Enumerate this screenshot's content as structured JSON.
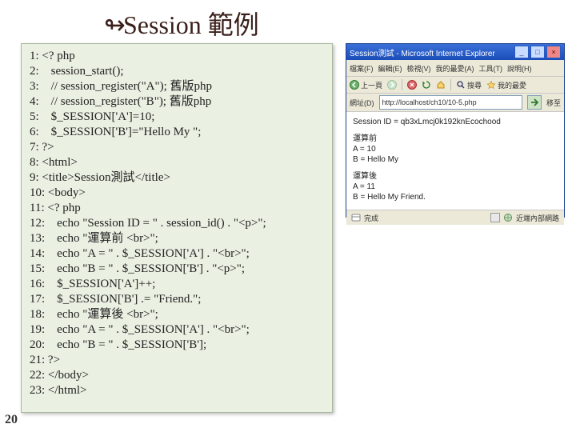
{
  "title_prefix_glyph": "↬",
  "title": "Session 範例",
  "page_number": "20",
  "code_lines": [
    "1: <? php",
    "2:    session_start();",
    "3:    // session_register(\"A\"); 舊版php",
    "4:    // session_register(\"B\"); 舊版php",
    "5:    $_SESSION['A']=10;",
    "6:    $_SESSION['B']=\"Hello My \";",
    "7: ?>",
    "8: <html>",
    "9: <title>Session測試</title>",
    "10: <body>",
    "11: <? php",
    "12:    echo \"Session ID = \" . session_id() . \"<p>\";",
    "13:    echo \"運算前 <br>\";",
    "14:    echo \"A = \" . $_SESSION['A'] . \"<br>\";",
    "15:    echo \"B = \" . $_SESSION['B'] . \"<p>\";",
    "16:    $_SESSION['A']++;",
    "17:    $_SESSION['B'] .= \"Friend.\";",
    "18:    echo \"運算後 <br>\";",
    "19:    echo \"A = \" . $_SESSION['A'] . \"<br>\";",
    "20:    echo \"B = \" . $_SESSION['B'];",
    "21: ?>",
    "22: </body>",
    "23: </html>"
  ],
  "browser": {
    "window_title": "Session測試 - Microsoft Internet Explorer",
    "menu": {
      "file": "檔案(F)",
      "edit": "編輯(E)",
      "view": "檢視(V)",
      "fav": "我的最愛(A)",
      "tools": "工具(T)",
      "help": "說明(H)"
    },
    "toolbar": {
      "back": "上一頁",
      "forward": "",
      "stop": "",
      "refresh": "",
      "home": "",
      "search": "搜尋",
      "favorites": "我的最愛"
    },
    "address_label": "網址(D)",
    "address_value": "http://localhost/ch10/10-5.php",
    "go_label": "移至",
    "body": {
      "session_line": "Session ID = qb3xLmcj0k192knEcochood",
      "before_header": "運算前",
      "before_a": "A = 10",
      "before_b": "B = Hello My",
      "after_header": "運算後",
      "after_a": "A = 11",
      "after_b": "B = Hello My Friend."
    },
    "status": {
      "done": "完成",
      "zone": "近端內部網路"
    }
  }
}
